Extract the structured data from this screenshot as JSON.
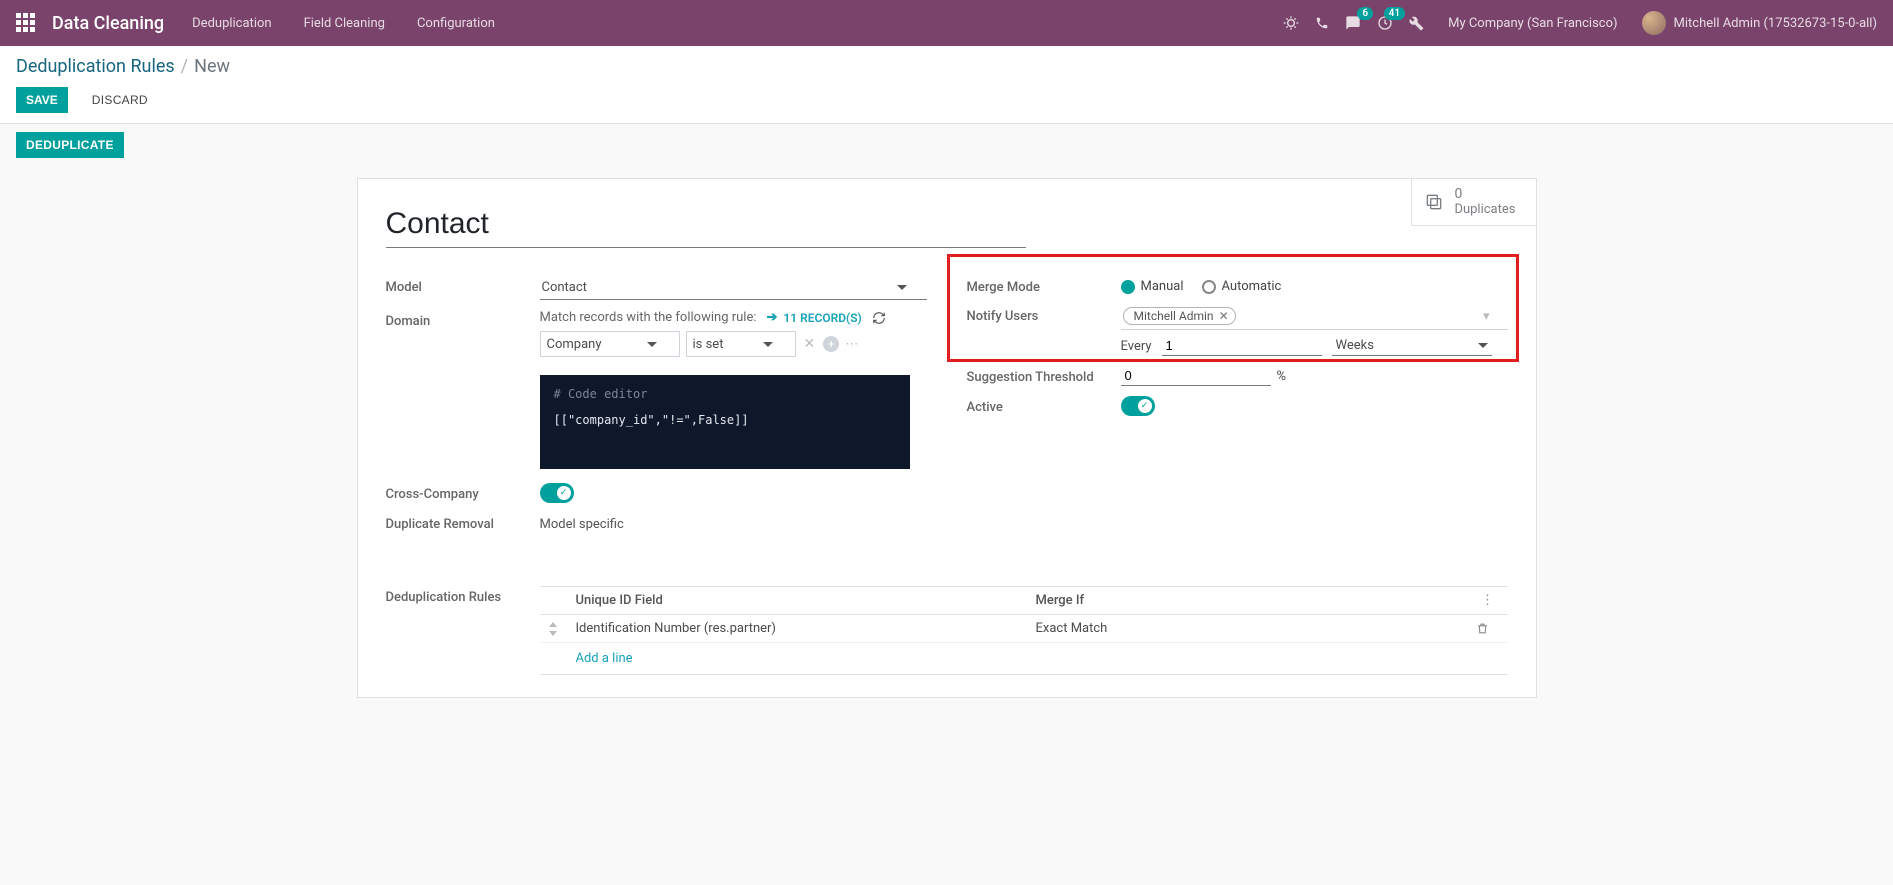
{
  "navbar": {
    "brand": "Data Cleaning",
    "menu": [
      "Deduplication",
      "Field Cleaning",
      "Configuration"
    ],
    "discuss_badge": "6",
    "activities_badge": "41",
    "company": "My Company (San Francisco)",
    "user": "Mitchell Admin (17532673-15-0-all)"
  },
  "breadcrumb": {
    "parent": "Deduplication Rules",
    "current": "New"
  },
  "cp": {
    "save": "SAVE",
    "discard": "DISCARD",
    "dedup": "DEDUPLICATE"
  },
  "stat": {
    "count": "0",
    "label": "Duplicates"
  },
  "title": "Contact",
  "left": {
    "model_label": "Model",
    "model_value": "Contact",
    "domain_label": "Domain",
    "domain_text": "Match records with the following rule:",
    "records_link": "11 RECORD(S)",
    "domain_field": "Company",
    "domain_op": "is set",
    "code_comment": "# Code editor",
    "code_body": "[[\"company_id\",\"!=\",False]]",
    "cross_label": "Cross-Company",
    "dup_removal_label": "Duplicate Removal",
    "dup_removal_value": "Model specific"
  },
  "right": {
    "merge_mode_label": "Merge Mode",
    "merge_manual": "Manual",
    "merge_auto": "Automatic",
    "notify_label": "Notify Users",
    "notify_tag": "Mitchell Admin",
    "every": "Every",
    "every_n": "1",
    "every_unit": "Weeks",
    "threshold_label": "Suggestion Threshold",
    "threshold_value": "0",
    "threshold_unit": "%",
    "active_label": "Active"
  },
  "subform": {
    "section_label": "Deduplication Rules",
    "col_uid": "Unique ID Field",
    "col_merge": "Merge If",
    "row_uid": "Identification Number (res.partner)",
    "row_merge": "Exact Match",
    "add_line": "Add a line"
  }
}
